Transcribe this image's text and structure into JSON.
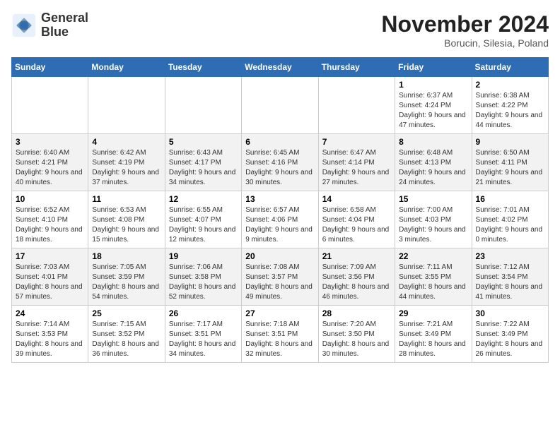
{
  "header": {
    "logo_line1": "General",
    "logo_line2": "Blue",
    "month_title": "November 2024",
    "subtitle": "Borucin, Silesia, Poland"
  },
  "days_of_week": [
    "Sunday",
    "Monday",
    "Tuesday",
    "Wednesday",
    "Thursday",
    "Friday",
    "Saturday"
  ],
  "weeks": [
    [
      {
        "day": "",
        "info": ""
      },
      {
        "day": "",
        "info": ""
      },
      {
        "day": "",
        "info": ""
      },
      {
        "day": "",
        "info": ""
      },
      {
        "day": "",
        "info": ""
      },
      {
        "day": "1",
        "info": "Sunrise: 6:37 AM\nSunset: 4:24 PM\nDaylight: 9 hours and 47 minutes."
      },
      {
        "day": "2",
        "info": "Sunrise: 6:38 AM\nSunset: 4:22 PM\nDaylight: 9 hours and 44 minutes."
      }
    ],
    [
      {
        "day": "3",
        "info": "Sunrise: 6:40 AM\nSunset: 4:21 PM\nDaylight: 9 hours and 40 minutes."
      },
      {
        "day": "4",
        "info": "Sunrise: 6:42 AM\nSunset: 4:19 PM\nDaylight: 9 hours and 37 minutes."
      },
      {
        "day": "5",
        "info": "Sunrise: 6:43 AM\nSunset: 4:17 PM\nDaylight: 9 hours and 34 minutes."
      },
      {
        "day": "6",
        "info": "Sunrise: 6:45 AM\nSunset: 4:16 PM\nDaylight: 9 hours and 30 minutes."
      },
      {
        "day": "7",
        "info": "Sunrise: 6:47 AM\nSunset: 4:14 PM\nDaylight: 9 hours and 27 minutes."
      },
      {
        "day": "8",
        "info": "Sunrise: 6:48 AM\nSunset: 4:13 PM\nDaylight: 9 hours and 24 minutes."
      },
      {
        "day": "9",
        "info": "Sunrise: 6:50 AM\nSunset: 4:11 PM\nDaylight: 9 hours and 21 minutes."
      }
    ],
    [
      {
        "day": "10",
        "info": "Sunrise: 6:52 AM\nSunset: 4:10 PM\nDaylight: 9 hours and 18 minutes."
      },
      {
        "day": "11",
        "info": "Sunrise: 6:53 AM\nSunset: 4:08 PM\nDaylight: 9 hours and 15 minutes."
      },
      {
        "day": "12",
        "info": "Sunrise: 6:55 AM\nSunset: 4:07 PM\nDaylight: 9 hours and 12 minutes."
      },
      {
        "day": "13",
        "info": "Sunrise: 6:57 AM\nSunset: 4:06 PM\nDaylight: 9 hours and 9 minutes."
      },
      {
        "day": "14",
        "info": "Sunrise: 6:58 AM\nSunset: 4:04 PM\nDaylight: 9 hours and 6 minutes."
      },
      {
        "day": "15",
        "info": "Sunrise: 7:00 AM\nSunset: 4:03 PM\nDaylight: 9 hours and 3 minutes."
      },
      {
        "day": "16",
        "info": "Sunrise: 7:01 AM\nSunset: 4:02 PM\nDaylight: 9 hours and 0 minutes."
      }
    ],
    [
      {
        "day": "17",
        "info": "Sunrise: 7:03 AM\nSunset: 4:01 PM\nDaylight: 8 hours and 57 minutes."
      },
      {
        "day": "18",
        "info": "Sunrise: 7:05 AM\nSunset: 3:59 PM\nDaylight: 8 hours and 54 minutes."
      },
      {
        "day": "19",
        "info": "Sunrise: 7:06 AM\nSunset: 3:58 PM\nDaylight: 8 hours and 52 minutes."
      },
      {
        "day": "20",
        "info": "Sunrise: 7:08 AM\nSunset: 3:57 PM\nDaylight: 8 hours and 49 minutes."
      },
      {
        "day": "21",
        "info": "Sunrise: 7:09 AM\nSunset: 3:56 PM\nDaylight: 8 hours and 46 minutes."
      },
      {
        "day": "22",
        "info": "Sunrise: 7:11 AM\nSunset: 3:55 PM\nDaylight: 8 hours and 44 minutes."
      },
      {
        "day": "23",
        "info": "Sunrise: 7:12 AM\nSunset: 3:54 PM\nDaylight: 8 hours and 41 minutes."
      }
    ],
    [
      {
        "day": "24",
        "info": "Sunrise: 7:14 AM\nSunset: 3:53 PM\nDaylight: 8 hours and 39 minutes."
      },
      {
        "day": "25",
        "info": "Sunrise: 7:15 AM\nSunset: 3:52 PM\nDaylight: 8 hours and 36 minutes."
      },
      {
        "day": "26",
        "info": "Sunrise: 7:17 AM\nSunset: 3:51 PM\nDaylight: 8 hours and 34 minutes."
      },
      {
        "day": "27",
        "info": "Sunrise: 7:18 AM\nSunset: 3:51 PM\nDaylight: 8 hours and 32 minutes."
      },
      {
        "day": "28",
        "info": "Sunrise: 7:20 AM\nSunset: 3:50 PM\nDaylight: 8 hours and 30 minutes."
      },
      {
        "day": "29",
        "info": "Sunrise: 7:21 AM\nSunset: 3:49 PM\nDaylight: 8 hours and 28 minutes."
      },
      {
        "day": "30",
        "info": "Sunrise: 7:22 AM\nSunset: 3:49 PM\nDaylight: 8 hours and 26 minutes."
      }
    ]
  ]
}
